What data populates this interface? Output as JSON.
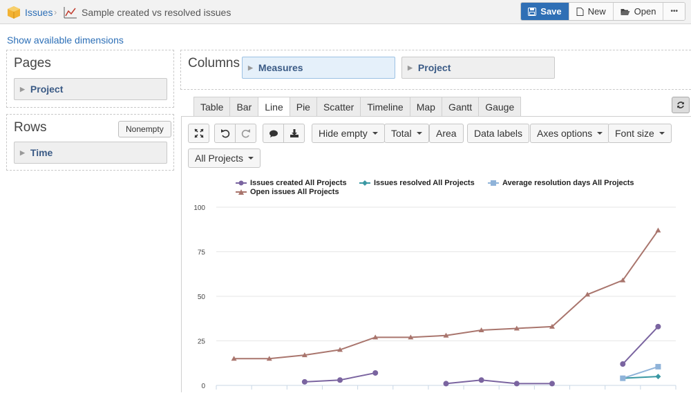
{
  "breadcrumb": {
    "root": "Issues",
    "sep": "›",
    "report": "Sample created vs resolved issues"
  },
  "toolbar": {
    "save": "Save",
    "new": "New",
    "open": "Open",
    "more": "•••"
  },
  "links": {
    "show_dims": "Show available dimensions"
  },
  "pages": {
    "title": "Pages",
    "chip": "Project"
  },
  "rows": {
    "title": "Rows",
    "nonempty": "Nonempty",
    "chip": "Time"
  },
  "columns": {
    "title": "Columns",
    "chips": [
      "Measures",
      "Project"
    ]
  },
  "tabs": [
    "Table",
    "Bar",
    "Line",
    "Pie",
    "Scatter",
    "Timeline",
    "Map",
    "Gantt",
    "Gauge"
  ],
  "active_tab": "Line",
  "chart_tools": {
    "hide_empty": "Hide empty",
    "total": "Total",
    "area": "Area",
    "data_labels": "Data labels",
    "axes_options": "Axes options",
    "font_size": "Font size",
    "projects": "All Projects"
  },
  "colors": {
    "created": "#7a64a0",
    "resolved": "#3a98a3",
    "avg": "#8fb3d9",
    "open": "#a9756d",
    "accent": "#2f6fb5"
  },
  "chart_data": {
    "type": "line",
    "title": "",
    "ylim": [
      0,
      100
    ],
    "yticks": [
      0,
      25,
      50,
      75,
      100
    ],
    "x": [
      1,
      2,
      3,
      4,
      5,
      6,
      7,
      8,
      9,
      10,
      11,
      12,
      13
    ],
    "series": [
      {
        "name": "Issues created All Projects",
        "marker": "circle",
        "values": [
          null,
          null,
          2,
          3,
          7,
          null,
          1,
          3,
          1,
          1,
          null,
          12,
          33
        ]
      },
      {
        "name": "Issues resolved All Projects",
        "marker": "diamond",
        "values": [
          null,
          null,
          null,
          null,
          null,
          null,
          null,
          null,
          null,
          null,
          null,
          4,
          5
        ]
      },
      {
        "name": "Average resolution days All Projects",
        "marker": "square",
        "values": [
          null,
          null,
          null,
          null,
          null,
          null,
          null,
          null,
          null,
          null,
          null,
          4,
          10.5
        ]
      },
      {
        "name": "Open issues All Projects",
        "marker": "triangle",
        "values": [
          15,
          15,
          17,
          20,
          27,
          27,
          28,
          31,
          32,
          33,
          51,
          59,
          87
        ]
      }
    ]
  }
}
